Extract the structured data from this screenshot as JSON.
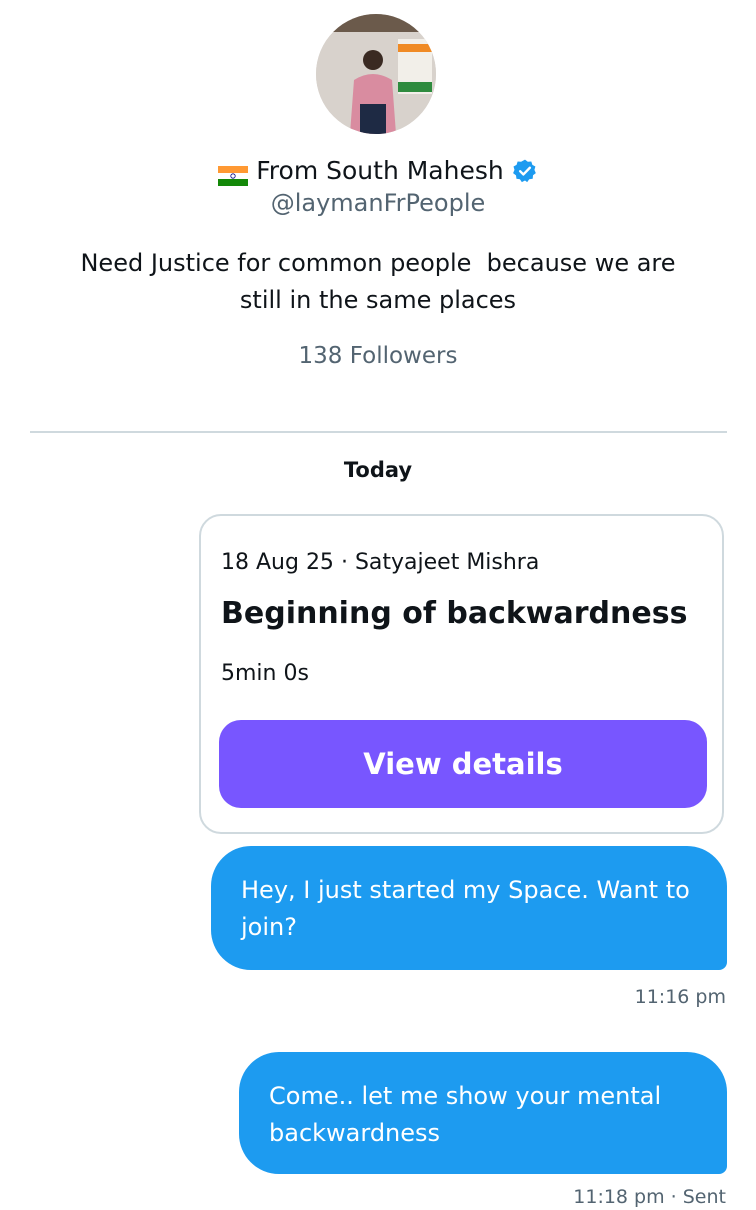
{
  "profile": {
    "name": "From South Mahesh",
    "flag_icon": "india-flag-icon",
    "verified_icon": "verified-badge-icon",
    "verified_color": "#1d9bf0",
    "handle": "@laymanFrPeople",
    "bio": "Need Justice for common people  because we are\nstill in the same places",
    "followers": "138 Followers"
  },
  "conversation": {
    "day_label": "Today",
    "space_card": {
      "date": "18 Aug 25",
      "separator": "·",
      "host": "Satyajeet Mishra",
      "title": "Beginning of backwardness",
      "duration": "5min 0s",
      "button_label": "View details",
      "button_color": "#7856ff"
    },
    "messages": [
      {
        "text": "Hey, I just started my Space. Want to join?",
        "time": "11:16 pm"
      },
      {
        "text": "Come.. let me show your mental backwardness",
        "time": "11:18 pm · Sent"
      }
    ],
    "bubble_color": "#1d9bf0"
  }
}
